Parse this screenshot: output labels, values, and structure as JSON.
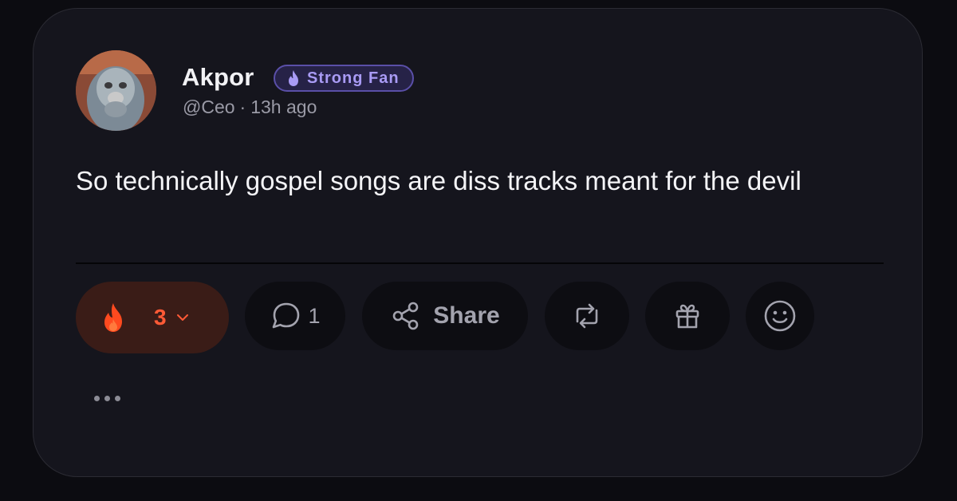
{
  "post": {
    "author": {
      "name": "Akpor",
      "handle": "@Ceo",
      "separator": "·",
      "time": "13h ago",
      "badge": {
        "label": "Strong Fan",
        "icon": "flame-icon",
        "color": "#a99bf5"
      }
    },
    "text": "So technically gospel songs are diss tracks meant for the devil"
  },
  "actions": {
    "reaction": {
      "icon": "flame-icon",
      "count": "3",
      "color": "#ff5a36"
    },
    "comment": {
      "icon": "comment-icon",
      "count": "1"
    },
    "share": {
      "icon": "share-icon",
      "label": "Share"
    },
    "repost": {
      "icon": "repost-icon"
    },
    "gift": {
      "icon": "gift-icon"
    },
    "emoji": {
      "icon": "smiley-icon"
    },
    "more": {
      "icon": "more-dots-icon"
    }
  }
}
